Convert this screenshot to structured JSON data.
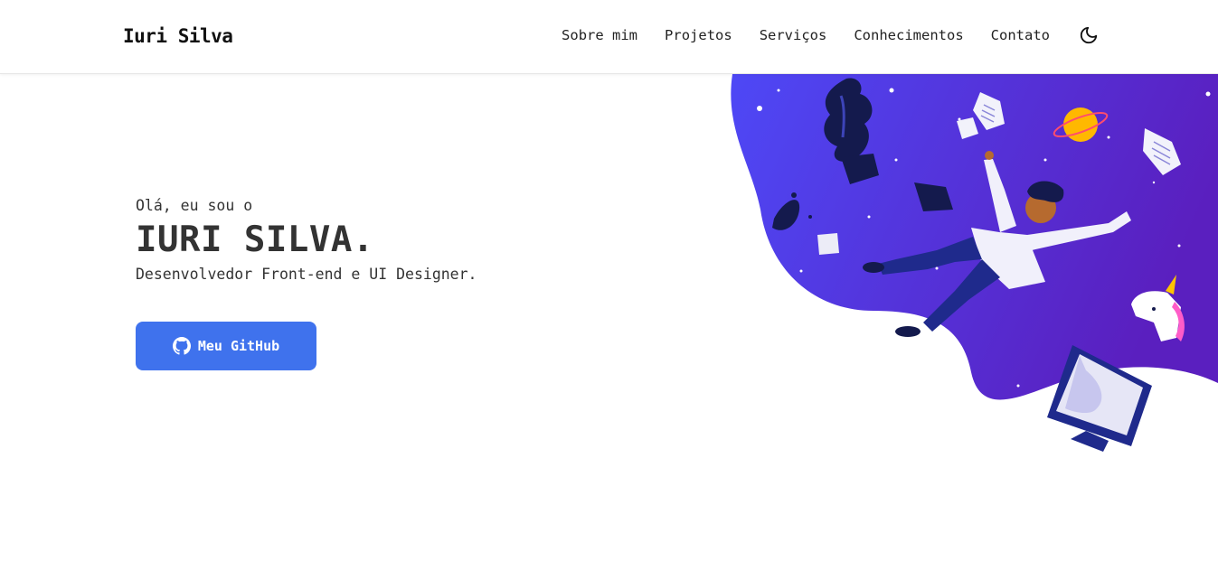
{
  "header": {
    "brand": "Iuri Silva",
    "nav": [
      "Sobre mim",
      "Projetos",
      "Serviços",
      "Conhecimentos",
      "Contato"
    ],
    "theme_icon": "moon-icon"
  },
  "hero": {
    "greeting": "Olá, eu sou o",
    "name": "IURI SILVA.",
    "role": "Desenvolvedor Front-end e UI Designer.",
    "button_label": "Meu GitHub",
    "button_icon": "github-icon"
  },
  "colors": {
    "accent": "#3f72ed",
    "gradient_start": "#4e48f6",
    "gradient_end": "#5a1fbf"
  }
}
